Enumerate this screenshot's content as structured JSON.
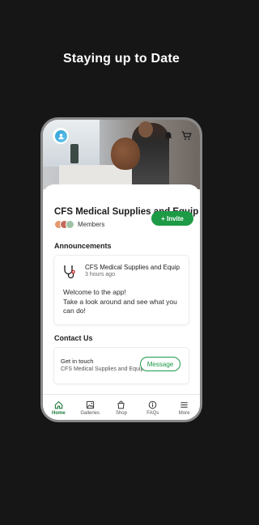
{
  "headline": "Staying up to Date",
  "site": {
    "title": "CFS Medical Supplies and Equip",
    "members_label": "Members",
    "invite_label": "+ Invite"
  },
  "announcements": {
    "heading": "Announcements",
    "post": {
      "author": "CFS Medical Supplies and Equip",
      "time": "3 hours ago",
      "body_line1": "Welcome to the app!",
      "body_line2": "Take a look around and see what you can do!"
    }
  },
  "contact": {
    "heading": "Contact Us",
    "title": "Get in touch",
    "subtitle": "CFS Medical Supplies and Equip",
    "button_label": "Message"
  },
  "tabs": [
    {
      "label": "Home",
      "icon": "home-icon",
      "active": true
    },
    {
      "label": "Galleries",
      "icon": "image-icon",
      "active": false
    },
    {
      "label": "Shop",
      "icon": "shopping-bag-icon",
      "active": false
    },
    {
      "label": "FAQs",
      "icon": "info-icon",
      "active": false
    },
    {
      "label": "More",
      "icon": "menu-icon",
      "active": false
    }
  ],
  "colors": {
    "background": "#161616",
    "accent": "#1d9a45",
    "active_tab": "#1d7a3d"
  }
}
